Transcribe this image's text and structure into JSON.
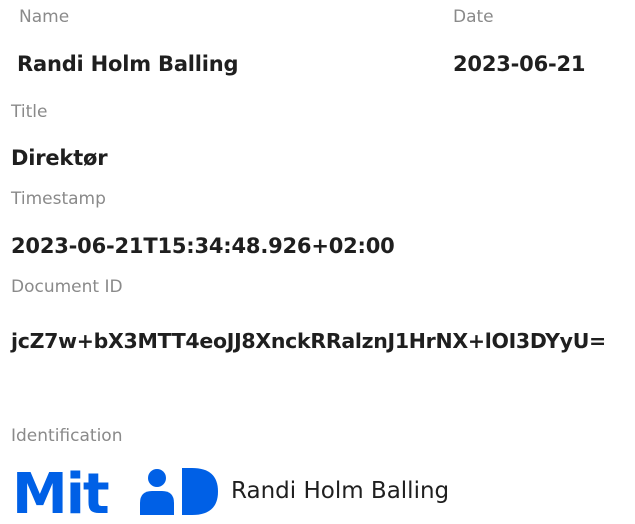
{
  "fields": {
    "name_label": "Name",
    "name_value": "Randi Holm Balling",
    "date_label": "Date",
    "date_value": "2023-06-21",
    "title_label": "Title",
    "title_value": "Direktør",
    "timestamp_label": "Timestamp",
    "timestamp_value": "2023-06-21T15:34:48.926+02:00",
    "document_id_label": "Document ID",
    "document_id_value": "jcZ7w+bX3MTT4eoJJ8XnckRRalznJ1HrNX+lOI3DYyU=",
    "identification_label": "Identification",
    "identification_name": "Randi Holm Balling"
  },
  "logo": {
    "text": "Mit",
    "icon": "mitid-person-icon",
    "color": "#0060e6"
  }
}
